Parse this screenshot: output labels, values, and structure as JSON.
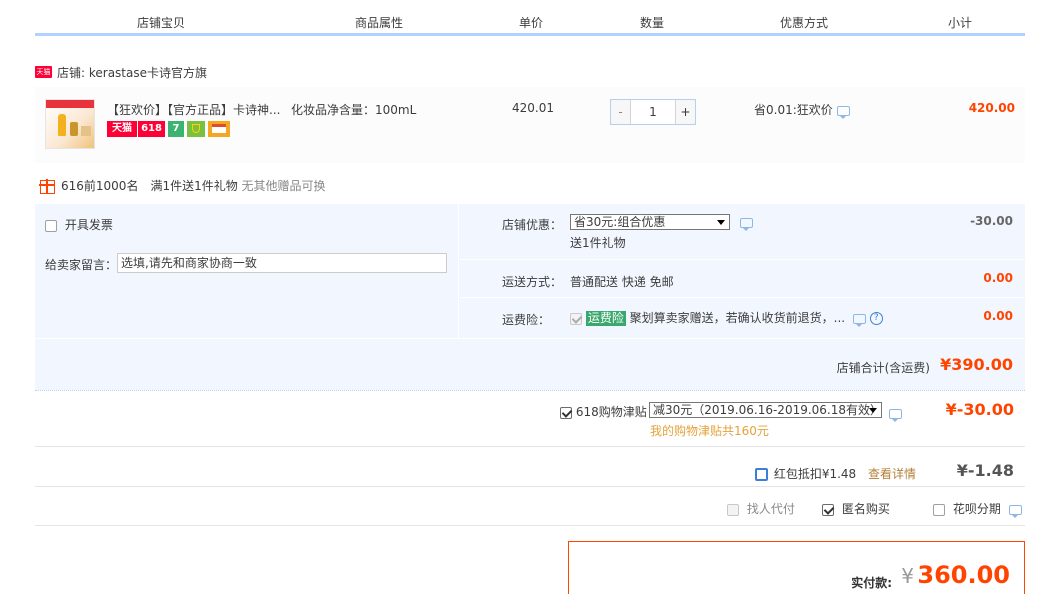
{
  "header": {
    "col_shop_item": "店铺宝贝",
    "col_attr": "商品属性",
    "col_price": "单价",
    "col_qty": "数量",
    "col_promo": "优惠方式",
    "col_subtotal": "小计"
  },
  "shop": {
    "badge": "天猫",
    "label": "店铺: kerastase卡诗官方旗"
  },
  "item": {
    "title": "【狂欢价】【官方正品】卡诗神...",
    "icons": [
      "天猫",
      "618",
      "7",
      "",
      ""
    ],
    "attr": "化妆品净含量：100mL",
    "price": "420.01",
    "qty_minus": "-",
    "qty_value": "1",
    "qty_plus": "+",
    "promo": "省0.01:狂欢价",
    "subtotal": "420.00"
  },
  "gift": {
    "main": "616前1000名　满1件送1件礼物",
    "muted": "无其他赠品可换"
  },
  "options": {
    "invoice_label": "开具发票",
    "message_label": "给卖家留言：",
    "message_placeholder": "选填,请先和商家协商一致",
    "shop_discount_label": "店铺优惠：",
    "shop_discount_value": "省30元:组合优惠",
    "shop_discount_note": "送1件礼物",
    "shop_discount_amount": "-30.00",
    "shipping_label": "运送方式：",
    "shipping_value": "普通配送 快递 免邮",
    "shipping_amount": "0.00",
    "insurance_label": "运费险：",
    "insurance_tag": "运费险",
    "insurance_text": "聚划算卖家赠送，若确认收货前退货，...",
    "insurance_amount": "0.00",
    "shop_total_label": "店铺合计(含运费)",
    "shop_total_value": "¥390.00"
  },
  "subsidy": {
    "label": "618购物津贴",
    "select_value": "减30元（2019.06.16-2019.06.18有效）",
    "note": "我的购物津贴共160元",
    "amount": "¥-30.00"
  },
  "redpacket": {
    "label": "红包抵扣¥1.48",
    "link": "查看详情",
    "amount": "¥-1.48"
  },
  "pay_options": {
    "friend_pay": "找人代付",
    "anonymous": "匿名购买",
    "installment": "花呗分期"
  },
  "payment": {
    "label": "实付款:",
    "currency": "¥",
    "amount": "360.00"
  },
  "colors": {
    "accent": "#ff4400",
    "header_line": "#b2d1ff",
    "option_bg": "#f2f7ff",
    "note_orange": "#e4a23c"
  }
}
